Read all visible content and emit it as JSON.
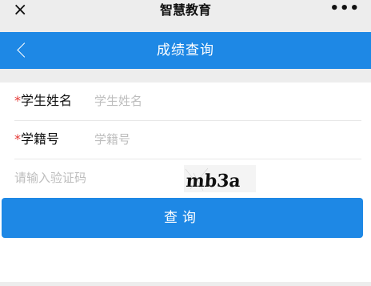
{
  "topbar": {
    "close_icon": "×",
    "title": "智慧教育",
    "more_icon": "•••"
  },
  "navbar": {
    "title": "成绩查询"
  },
  "form": {
    "name": {
      "required_mark": "*",
      "label": "学生姓名",
      "placeholder": "学生姓名"
    },
    "student_no": {
      "required_mark": "*",
      "label": "学籍号",
      "placeholder": "学籍号"
    },
    "captcha": {
      "placeholder": "请输入验证码",
      "image_text": "mb3a"
    }
  },
  "actions": {
    "query_label": "查询"
  },
  "colors": {
    "primary": "#1e88e5",
    "required": "#e53935",
    "placeholder": "#bdbdbd"
  }
}
